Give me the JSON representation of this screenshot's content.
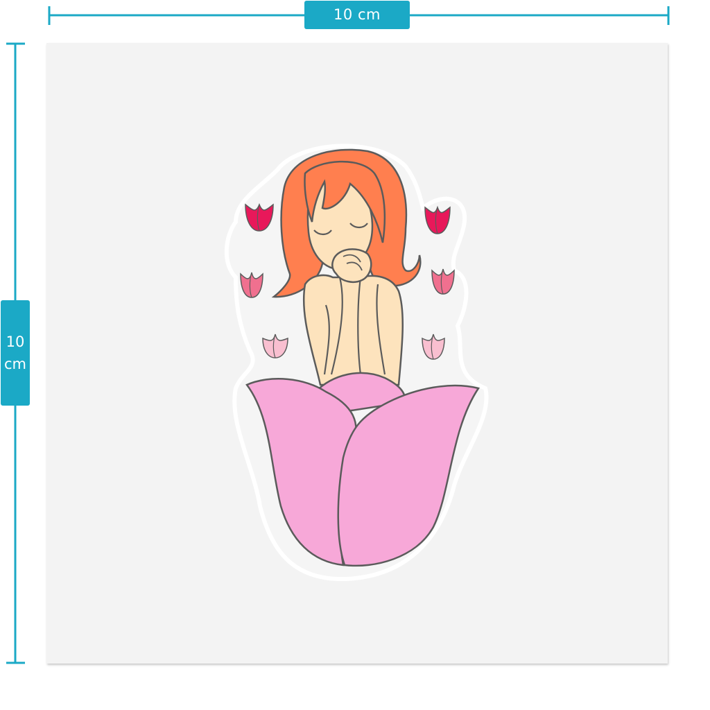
{
  "dimensions": {
    "width_label": "10 cm",
    "height_value": "10",
    "height_unit": "cm"
  },
  "colors": {
    "accent": "#1ba9c6",
    "sheet": "#f3f3f3",
    "hair": "#ff7f4f",
    "skin": "#fde3bd",
    "petal": "#f7a8d8",
    "tulip_red": "#e8185a",
    "tulip_pink": "#f0708f",
    "tulip_light": "#f9bfd0",
    "outline": "#5b5b5b"
  },
  "illustration": {
    "subject": "girl-in-tulip",
    "icons": [
      "tulip-icon",
      "tulip-icon",
      "tulip-icon",
      "tulip-icon",
      "tulip-icon",
      "tulip-icon"
    ]
  }
}
